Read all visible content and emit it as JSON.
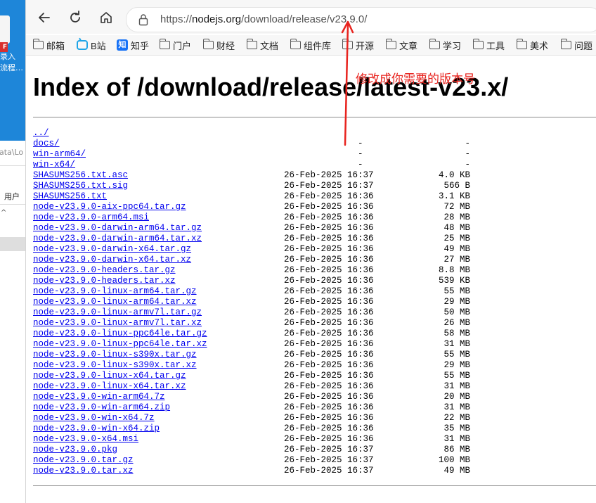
{
  "desktop": {
    "pdf_badge": "F",
    "line1": "录入",
    "line2": "流程…",
    "path_fragment": "ata\\Lo",
    "user_label": "用户",
    "caret": "^"
  },
  "browser": {
    "url_prefix": "https://",
    "url_host": "nodejs.org",
    "url_path": "/download/release/v23.9.0/",
    "bookmarks": [
      {
        "label": "邮箱",
        "icon": "folder-icon"
      },
      {
        "label": "B站",
        "icon": "bilibili-icon"
      },
      {
        "label": "知乎",
        "icon": "zhihu-icon",
        "icon_text": "知"
      },
      {
        "label": "门户",
        "icon": "folder-icon"
      },
      {
        "label": "财经",
        "icon": "folder-icon"
      },
      {
        "label": "文档",
        "icon": "folder-icon"
      },
      {
        "label": "组件库",
        "icon": "folder-icon"
      },
      {
        "label": "开源",
        "icon": "folder-icon"
      },
      {
        "label": "文章",
        "icon": "folder-icon"
      },
      {
        "label": "学习",
        "icon": "folder-icon"
      },
      {
        "label": "工具",
        "icon": "folder-icon"
      },
      {
        "label": "美术",
        "icon": "folder-icon"
      },
      {
        "label": "问题",
        "icon": "folder-icon"
      }
    ]
  },
  "page": {
    "title": "Index of /download/release/latest-v23.x/",
    "files": [
      {
        "name": "../",
        "date": "",
        "size": ""
      },
      {
        "name": "docs/",
        "date": "-",
        "size": "-"
      },
      {
        "name": "win-arm64/",
        "date": "-",
        "size": "-"
      },
      {
        "name": "win-x64/",
        "date": "-",
        "size": "-"
      },
      {
        "name": "SHASUMS256.txt.asc",
        "date": "26-Feb-2025 16:37",
        "size": "4.0 KB"
      },
      {
        "name": "SHASUMS256.txt.sig",
        "date": "26-Feb-2025 16:37",
        "size": "566 B"
      },
      {
        "name": "SHASUMS256.txt",
        "date": "26-Feb-2025 16:36",
        "size": "3.1 KB"
      },
      {
        "name": "node-v23.9.0-aix-ppc64.tar.gz",
        "date": "26-Feb-2025 16:36",
        "size": "72 MB"
      },
      {
        "name": "node-v23.9.0-arm64.msi",
        "date": "26-Feb-2025 16:36",
        "size": "28 MB"
      },
      {
        "name": "node-v23.9.0-darwin-arm64.tar.gz",
        "date": "26-Feb-2025 16:36",
        "size": "48 MB"
      },
      {
        "name": "node-v23.9.0-darwin-arm64.tar.xz",
        "date": "26-Feb-2025 16:36",
        "size": "25 MB"
      },
      {
        "name": "node-v23.9.0-darwin-x64.tar.gz",
        "date": "26-Feb-2025 16:36",
        "size": "49 MB"
      },
      {
        "name": "node-v23.9.0-darwin-x64.tar.xz",
        "date": "26-Feb-2025 16:36",
        "size": "27 MB"
      },
      {
        "name": "node-v23.9.0-headers.tar.gz",
        "date": "26-Feb-2025 16:36",
        "size": "8.8 MB"
      },
      {
        "name": "node-v23.9.0-headers.tar.xz",
        "date": "26-Feb-2025 16:36",
        "size": "539 KB"
      },
      {
        "name": "node-v23.9.0-linux-arm64.tar.gz",
        "date": "26-Feb-2025 16:36",
        "size": "55 MB"
      },
      {
        "name": "node-v23.9.0-linux-arm64.tar.xz",
        "date": "26-Feb-2025 16:36",
        "size": "29 MB"
      },
      {
        "name": "node-v23.9.0-linux-armv7l.tar.gz",
        "date": "26-Feb-2025 16:36",
        "size": "50 MB"
      },
      {
        "name": "node-v23.9.0-linux-armv7l.tar.xz",
        "date": "26-Feb-2025 16:36",
        "size": "26 MB"
      },
      {
        "name": "node-v23.9.0-linux-ppc64le.tar.gz",
        "date": "26-Feb-2025 16:36",
        "size": "58 MB"
      },
      {
        "name": "node-v23.9.0-linux-ppc64le.tar.xz",
        "date": "26-Feb-2025 16:36",
        "size": "31 MB"
      },
      {
        "name": "node-v23.9.0-linux-s390x.tar.gz",
        "date": "26-Feb-2025 16:36",
        "size": "55 MB"
      },
      {
        "name": "node-v23.9.0-linux-s390x.tar.xz",
        "date": "26-Feb-2025 16:36",
        "size": "29 MB"
      },
      {
        "name": "node-v23.9.0-linux-x64.tar.gz",
        "date": "26-Feb-2025 16:36",
        "size": "55 MB"
      },
      {
        "name": "node-v23.9.0-linux-x64.tar.xz",
        "date": "26-Feb-2025 16:36",
        "size": "31 MB"
      },
      {
        "name": "node-v23.9.0-win-arm64.7z",
        "date": "26-Feb-2025 16:36",
        "size": "20 MB"
      },
      {
        "name": "node-v23.9.0-win-arm64.zip",
        "date": "26-Feb-2025 16:36",
        "size": "31 MB"
      },
      {
        "name": "node-v23.9.0-win-x64.7z",
        "date": "26-Feb-2025 16:36",
        "size": "22 MB"
      },
      {
        "name": "node-v23.9.0-win-x64.zip",
        "date": "26-Feb-2025 16:36",
        "size": "35 MB"
      },
      {
        "name": "node-v23.9.0-x64.msi",
        "date": "26-Feb-2025 16:36",
        "size": "31 MB"
      },
      {
        "name": "node-v23.9.0.pkg",
        "date": "26-Feb-2025 16:37",
        "size": "86 MB"
      },
      {
        "name": "node-v23.9.0.tar.gz",
        "date": "26-Feb-2025 16:37",
        "size": "100 MB"
      },
      {
        "name": "node-v23.9.0.tar.xz",
        "date": "26-Feb-2025 16:37",
        "size": "49 MB"
      }
    ]
  },
  "annotation": {
    "text": "修改成你需要的版本号",
    "color": "#e8231e"
  }
}
